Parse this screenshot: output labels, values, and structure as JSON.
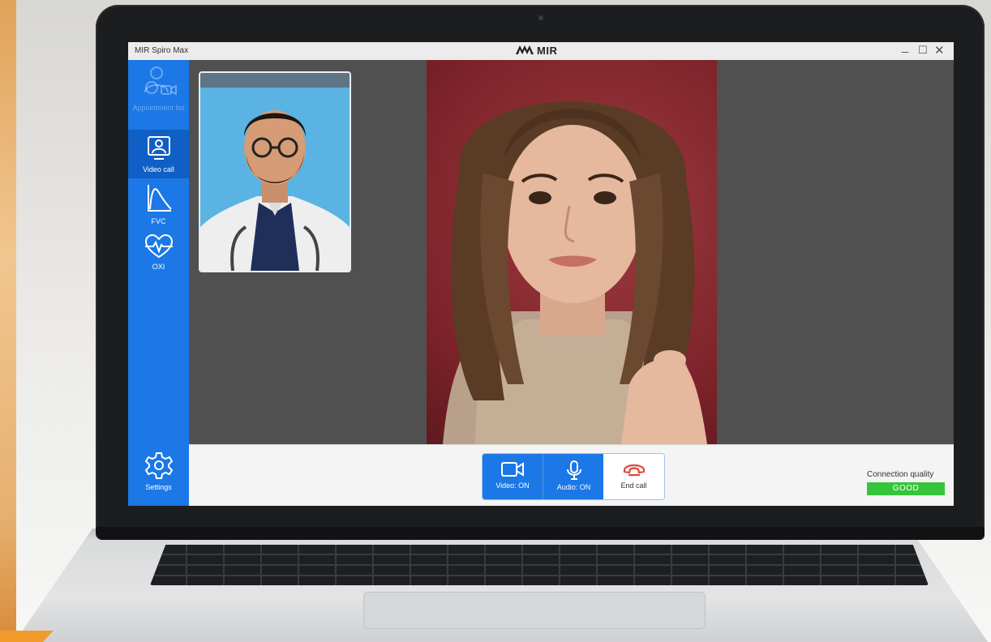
{
  "window": {
    "app_title": "MIR Spiro Max",
    "brand": "MIR"
  },
  "sidebar": {
    "items": [
      {
        "label": "Appointment list",
        "icon": "appointment-list-icon",
        "state": "disabled"
      },
      {
        "label": "Video call",
        "icon": "video-call-icon",
        "state": "active"
      },
      {
        "label": "FVC",
        "icon": "fvc-curve-icon",
        "state": "normal"
      },
      {
        "label": "OXI",
        "icon": "heart-pulse-icon",
        "state": "normal"
      }
    ],
    "settings": {
      "label": "Settings",
      "icon": "gear-icon"
    }
  },
  "call": {
    "controls": {
      "video_label": "Video: ON",
      "audio_label": "Audio: ON",
      "end_label": "End call"
    },
    "connection": {
      "label": "Connection quality",
      "value": "GOOD"
    }
  },
  "colors": {
    "accent": "#1b78e6",
    "accent_active": "#0f5fc4",
    "good": "#35c53a",
    "end_call": "#e2463f",
    "video_bg": "#505050"
  }
}
